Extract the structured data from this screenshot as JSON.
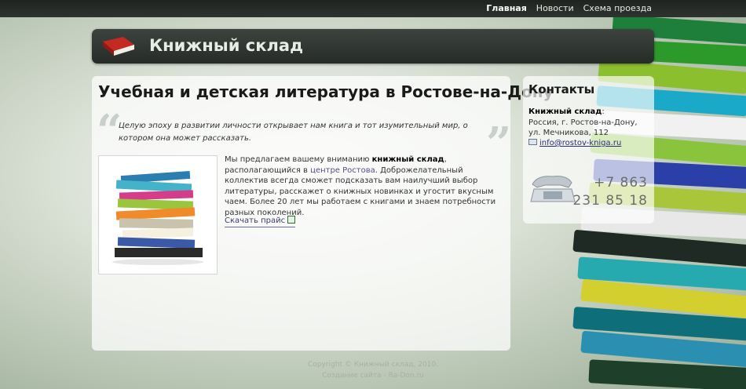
{
  "nav": {
    "items": [
      {
        "label": "Главная",
        "active": true
      },
      {
        "label": "Новости",
        "active": false
      },
      {
        "label": "Схема проезда",
        "active": false
      }
    ]
  },
  "header": {
    "site_title": "Книжный склад",
    "logo_icon": "book-icon"
  },
  "main": {
    "heading": "Учебная и детская литература в Ростове-на-Дону",
    "quote": "Целую эпоху в развитии личности открывает нам книга и тот изумительный мир, о котором она может рассказать.",
    "intro_before": "Мы предлагаем вашему вниманию ",
    "intro_bold": "книжный склад",
    "intro_middle": ", располагающийся в ",
    "intro_link": "центре Ростова",
    "intro_after": ". Доброжелательный коллектив всегда сможет подсказать вам наилучший выбор литературы, расскажет о книжных новинках и угостит вкусным чаем. Более 20 лет мы работаем с книгами и знаем потребности разных поколений.",
    "download_label": "Скачать прайс",
    "download_icon": "excel-icon"
  },
  "contacts": {
    "title": "Контакты",
    "company": "Книжный склад",
    "company_suffix": ":",
    "address_line1": "Россия, г. Ростов-на-Дону,",
    "address_line2": "ул. Мечникова, 112",
    "email": "info@rostov-kniga.ru",
    "phone_code": "+7 863",
    "phone_number": "231 85 18"
  },
  "footer": {
    "copyright": "Copyright © Книжный склад, 2010.",
    "credit": "Создание сайта - Ra-Don.ru"
  },
  "colors": {
    "header_bg": "#2d332e",
    "link": "#5a4a8a",
    "phone": "#6d6d6d"
  }
}
